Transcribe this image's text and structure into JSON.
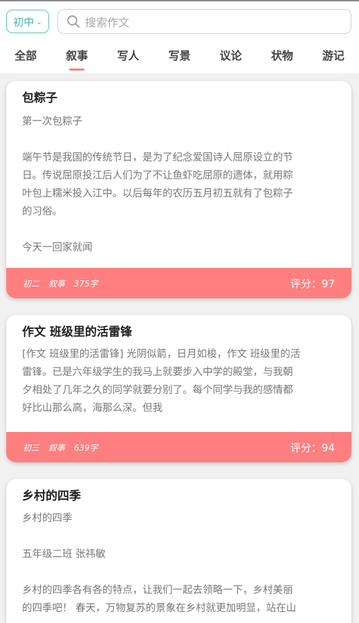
{
  "header": {
    "grade_label": "初中",
    "search_placeholder": "搜索作文"
  },
  "tabs": [
    {
      "label": "全部"
    },
    {
      "label": "叙事"
    },
    {
      "label": "写人"
    },
    {
      "label": "写景"
    },
    {
      "label": "议论"
    },
    {
      "label": "状物"
    },
    {
      "label": "游记"
    }
  ],
  "active_tab": "叙事",
  "essays": [
    {
      "title": "包粽子",
      "lines": [
        "第一次包粽子",
        "",
        "端午节是我国的传统节日，是为了纪念爱国诗人屈原设立的节",
        "日。传说屈原投江后人们为了不让鱼虾吃屈原的遗体，就用粽",
        "叶包上糯米投入江中。以后每年的农历五月初五就有了包粽子",
        "的习俗。",
        "",
        "今天一回家就闻"
      ],
      "grade": "初二",
      "category": "叙事",
      "word_count": "375字",
      "score": "评分：97"
    },
    {
      "title": "作文 班级里的活雷锋",
      "lines": [
        "[作文 班级里的活雷锋] 光阴似箭，日月如梭，作文 班级里的活",
        "雷锋。已是六年级学生的我马上就要步入中学的殿堂，与我朝",
        "夕相处了几年之久的同学就要分别了。每个同学与我的感情都",
        "好比山那么高，海那么深。但我"
      ],
      "grade": "初三",
      "category": "叙事",
      "word_count": "639字",
      "score": "评分：94"
    },
    {
      "title": "乡村的四季",
      "lines": [
        "乡村的四季",
        "",
        "五年级二班 张祎敏",
        "",
        "乡村的四季各有各的特点，让我们一起去领略一下，乡村美丽",
        "的四季吧！ 春天，万物复苏的景象在乡村就更加明显，站在山"
      ]
    }
  ],
  "colors": {
    "accent": "#ff7f80",
    "teal": "#47b3a5"
  }
}
